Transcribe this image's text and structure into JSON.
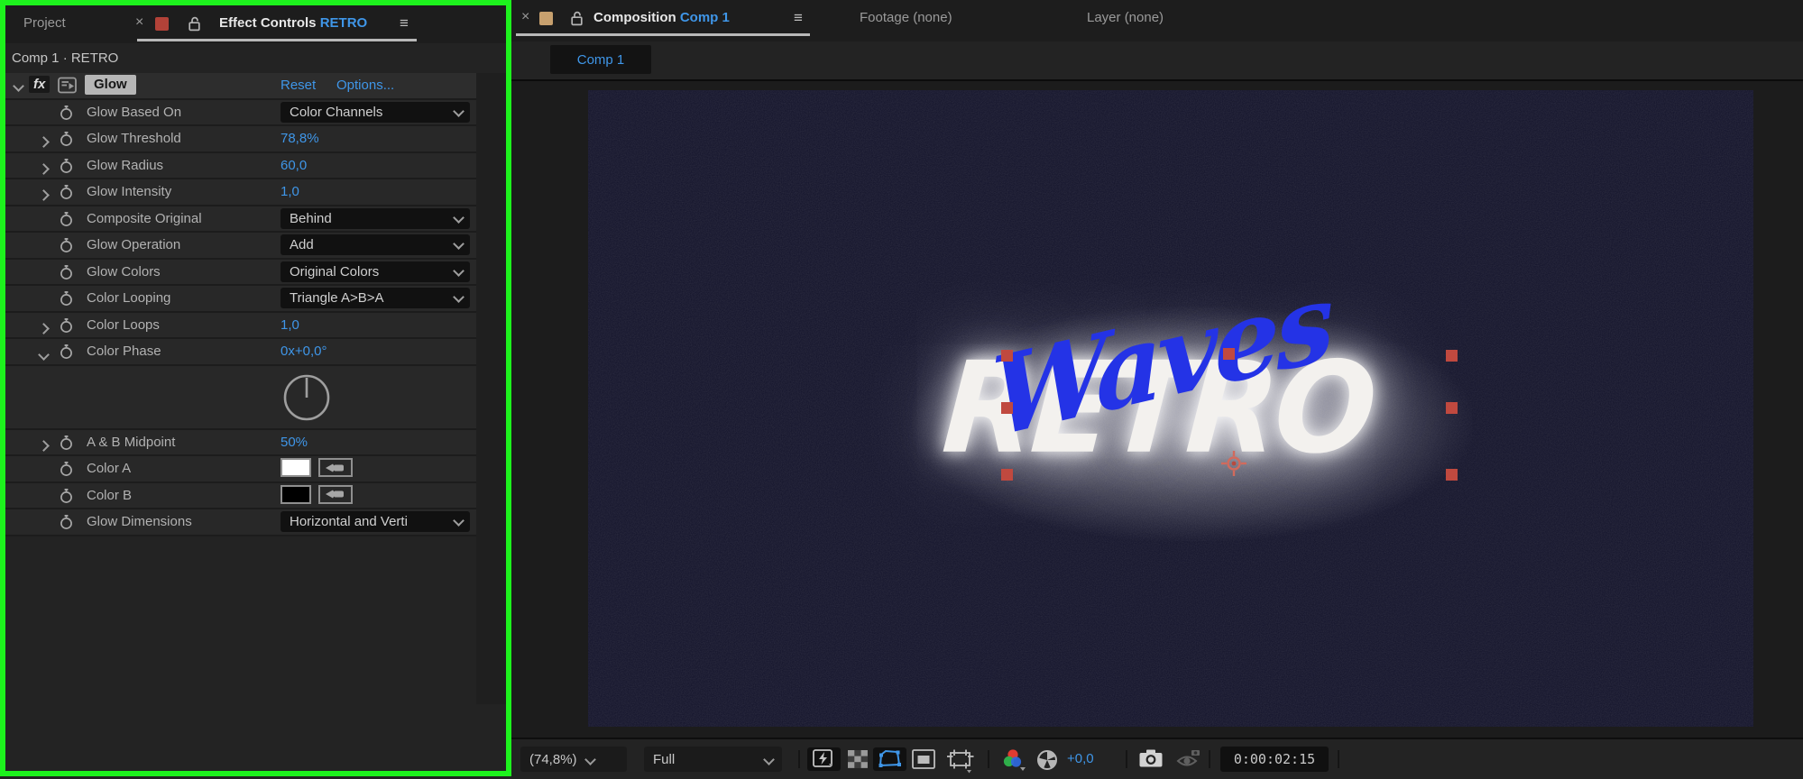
{
  "left_panel": {
    "tabs": {
      "project_label": "Project",
      "close_glyph": "×",
      "active_title": "Effect Controls",
      "active_target": "RETRO",
      "menu_glyph": "≡"
    },
    "breadcrumb": "Comp 1 · RETRO",
    "effect_header": {
      "fx_glyph": "fx",
      "effect_name": "Glow",
      "reset_label": "Reset",
      "options_label": "Options..."
    },
    "rows": [
      {
        "label": "Glow Based On",
        "expander": "",
        "value_type": "dropdown",
        "value": "Color Channels"
      },
      {
        "label": "Glow Threshold",
        "expander": "right",
        "value_type": "number",
        "value": "78,8%"
      },
      {
        "label": "Glow Radius",
        "expander": "right",
        "value_type": "number",
        "value": "60,0"
      },
      {
        "label": "Glow Intensity",
        "expander": "right",
        "value_type": "number",
        "value": "1,0"
      },
      {
        "label": "Composite Original",
        "expander": "",
        "value_type": "dropdown",
        "value": "Behind"
      },
      {
        "label": "Glow Operation",
        "expander": "",
        "value_type": "dropdown",
        "value": "Add"
      },
      {
        "label": "Glow Colors",
        "expander": "",
        "value_type": "dropdown",
        "value": "Original Colors"
      },
      {
        "label": "Color Looping",
        "expander": "",
        "value_type": "dropdown",
        "value": "Triangle A>B>A"
      },
      {
        "label": "Color Loops",
        "expander": "right",
        "value_type": "number",
        "value": "1,0"
      },
      {
        "label": "Color Phase",
        "expander": "down",
        "value_type": "number",
        "value": "0x+0,0°"
      },
      {
        "label": "",
        "expander": "",
        "value_type": "dial",
        "value": ""
      },
      {
        "label": "A & B Midpoint",
        "expander": "right",
        "value_type": "number",
        "value": "50%"
      },
      {
        "label": "Color A",
        "expander": "",
        "value_type": "swatch",
        "value": "#ffffff"
      },
      {
        "label": "Color B",
        "expander": "",
        "value_type": "swatch",
        "value": "#000000"
      },
      {
        "label": "Glow Dimensions",
        "expander": "",
        "value_type": "dropdown",
        "value": "Horizontal and Verti"
      }
    ]
  },
  "right_panel": {
    "tabs": {
      "close_glyph": "×",
      "active_title": "Composition",
      "active_target": "Comp 1",
      "menu_glyph": "≡",
      "footage_label": "Footage (none)",
      "layer_label": "Layer (none)"
    },
    "viewer_tab": "Comp 1",
    "canvas": {
      "title_text": "RETRO",
      "script_text": "Waves"
    },
    "toolbar": {
      "zoom_level": "(74,8%)",
      "resolution": "Full",
      "exposure_offset": "+0,0",
      "timecode": "0:00:02:15"
    }
  },
  "colors": {
    "accent_blue": "#3f96e8",
    "selection_red": "#c0493f",
    "frame_green": "#1df21d",
    "comp_background": "#13132a",
    "title_white": "#f3f1ee",
    "script_blue": "#2433e6",
    "panel_chip_red": "#b24238",
    "panel_chip_tan": "#c7a06e"
  }
}
